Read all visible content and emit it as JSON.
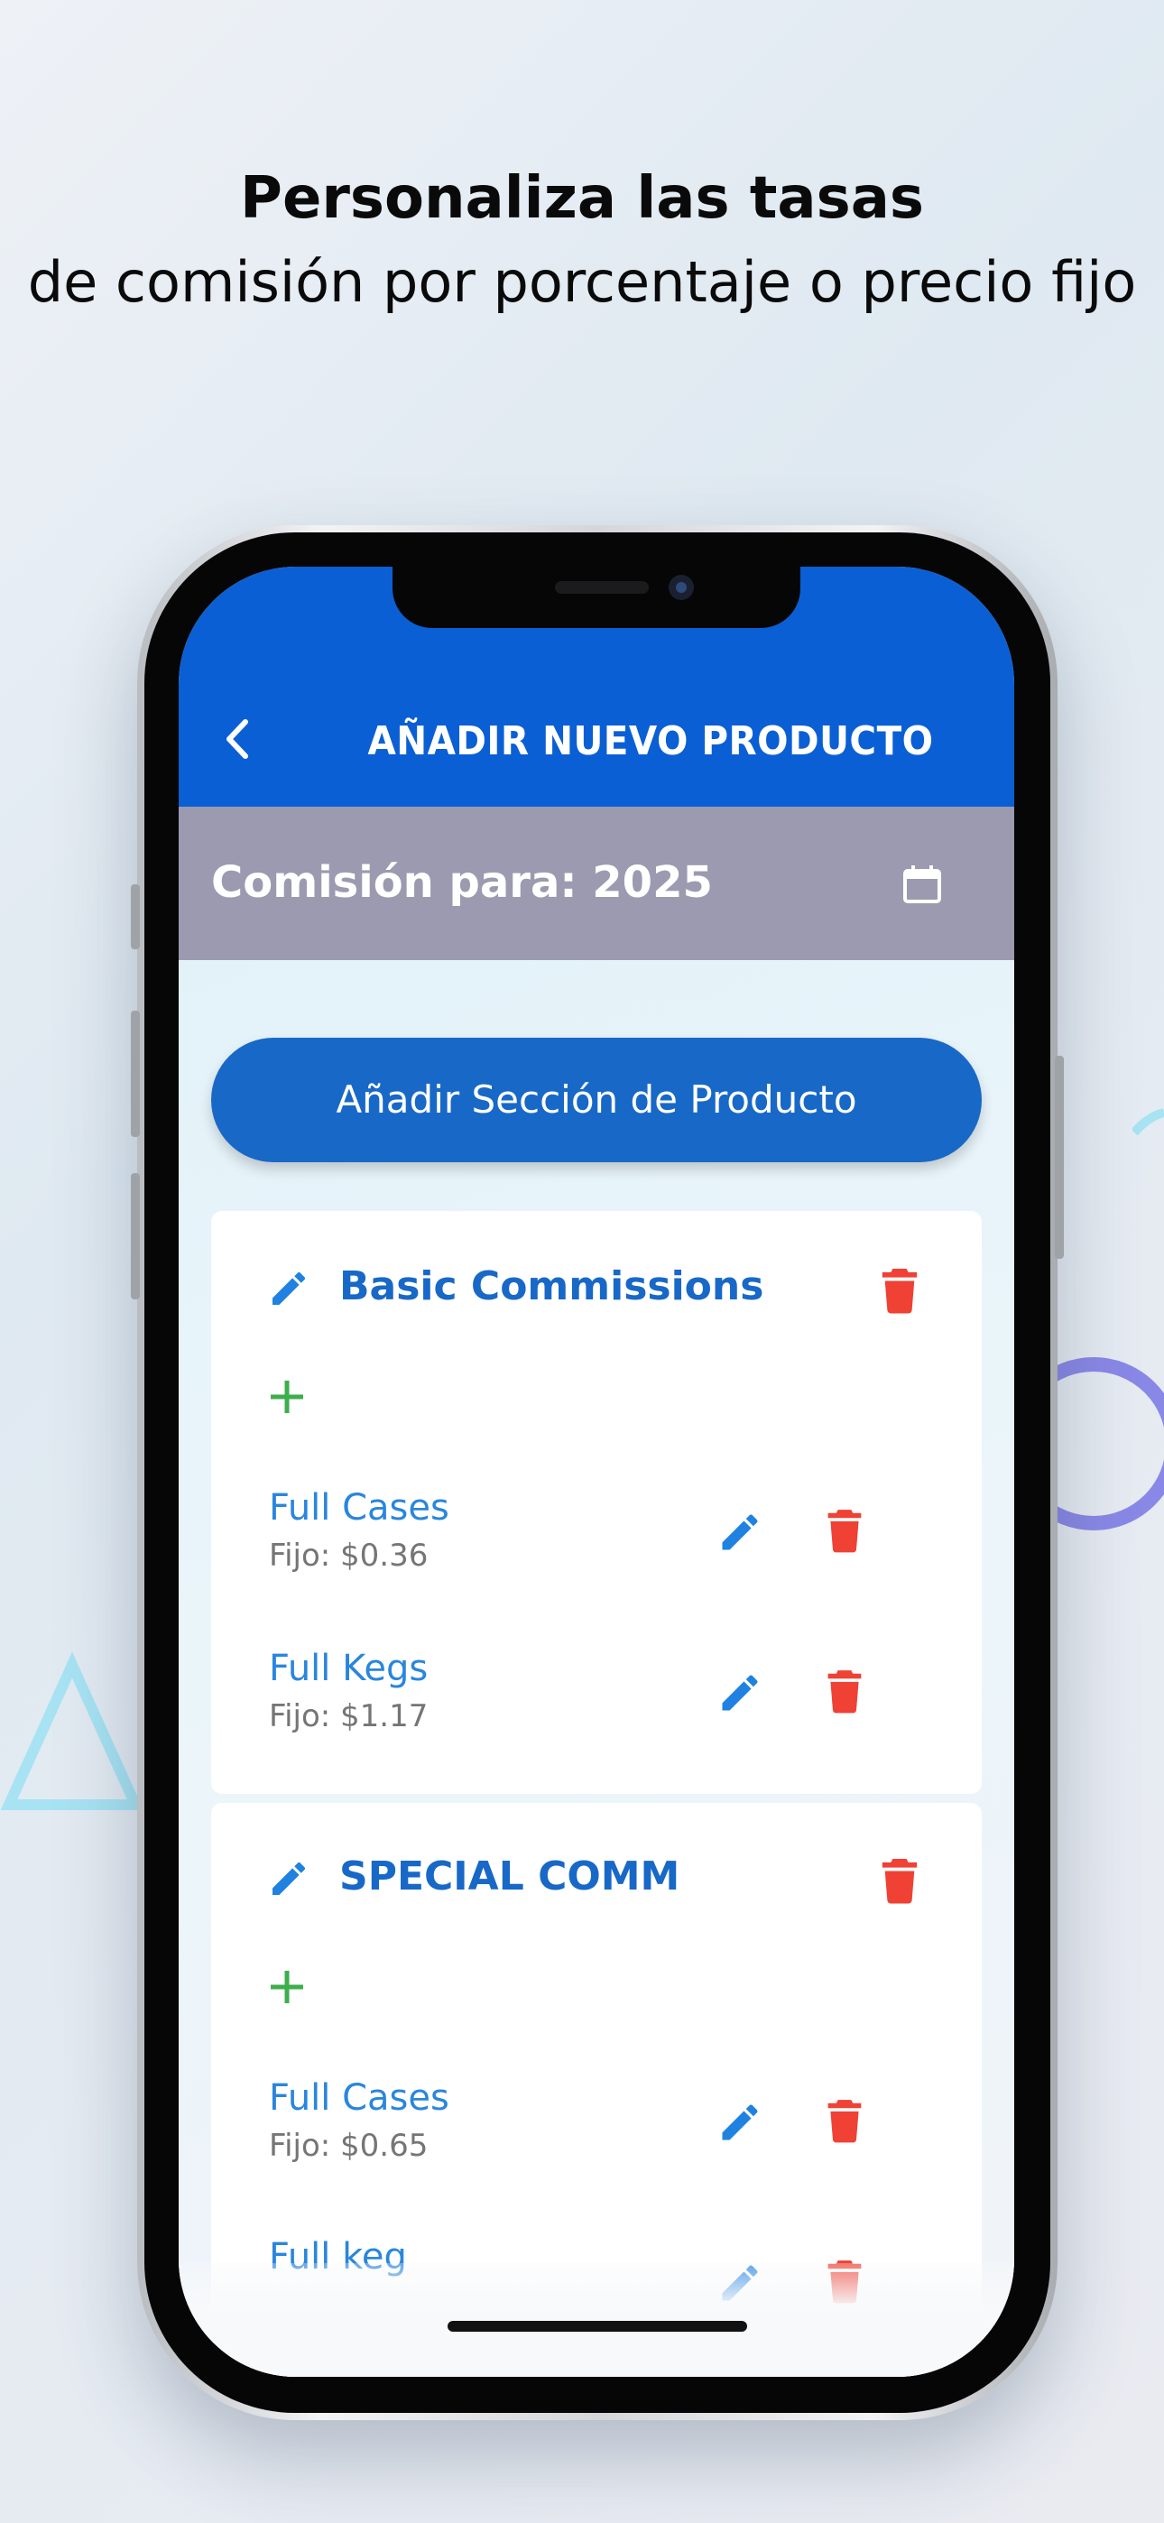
{
  "headline": {
    "line1": "Personaliza las tasas",
    "line2": "de comisión por porcentaje o precio fijo"
  },
  "app": {
    "title": "AÑADIR NUEVO PRODUCTO",
    "year_label": "Comisión para: 2025",
    "add_section_label": "Añadir Sección de Producto"
  },
  "sections": [
    {
      "title": "Basic Commissions",
      "items": [
        {
          "name": "Full Cases",
          "rate": "Fijo: $0.36"
        },
        {
          "name": "Full Kegs",
          "rate": "Fijo: $1.17"
        }
      ]
    },
    {
      "title": "SPECIAL COMM",
      "items": [
        {
          "name": "Full Cases",
          "rate": "Fijo: $0.65"
        },
        {
          "name": "Full keg"
        }
      ]
    }
  ],
  "icons": {
    "back": "chevron-left-icon",
    "calendar": "calendar-icon",
    "edit": "pencil-icon",
    "delete": "trash-icon",
    "add": "plus-icon"
  },
  "colors": {
    "primary": "#0b5fd4",
    "button": "#1868c7",
    "year_bar": "#9c9ab0",
    "edit_blue": "#2a86dc",
    "delete_red": "#ef4134",
    "add_green": "#3cae4c"
  }
}
